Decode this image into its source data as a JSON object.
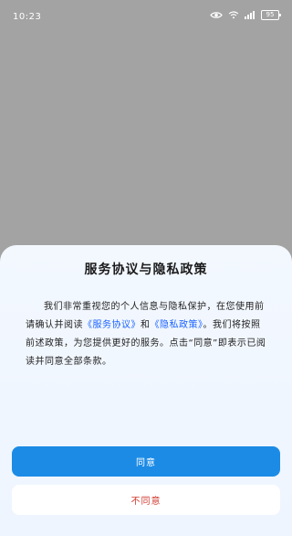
{
  "status": {
    "time": "10:23",
    "battery": "95",
    "icons": [
      "eye-icon",
      "wifi-icon",
      "signal-icon",
      "battery-icon"
    ]
  },
  "dialog": {
    "title": "服务协议与隐私政策",
    "text_before": "我们非常重视您的个人信息与隐私保护，在您使用前请确认并阅读",
    "link_service": "《服务协议》",
    "and": "和",
    "link_privacy": "《隐私政策》",
    "text_after": "。我们将按照前述政策，为您提供更好的服务。点击“同意”即表示已阅读并同意全部条款。",
    "agree_label": "同意",
    "disagree_label": "不同意"
  },
  "colors": {
    "overlay": "#a3a3a3",
    "accent": "#1b8be6",
    "link": "#1b63ff",
    "danger": "#d03a2f"
  }
}
